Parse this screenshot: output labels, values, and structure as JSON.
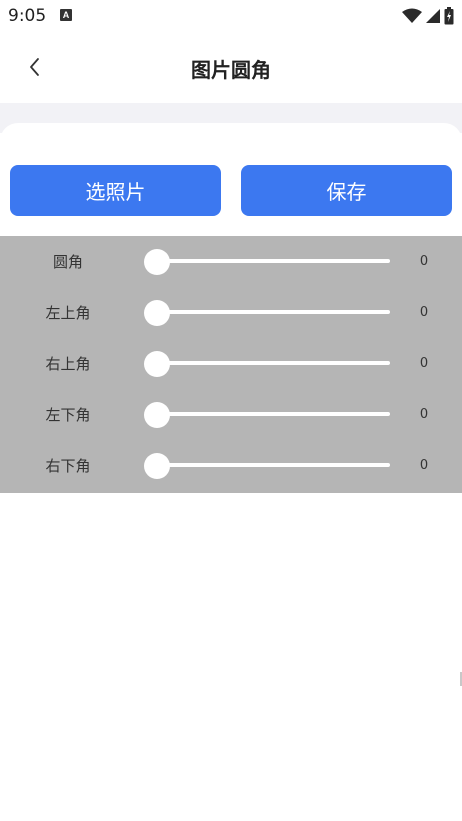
{
  "status_bar": {
    "time": "9:05",
    "notification_badge": "A",
    "icons": [
      "wifi-icon",
      "signal-icon",
      "battery-icon"
    ]
  },
  "header": {
    "title": "图片圆角",
    "back_icon": "chevron-left-icon"
  },
  "actions": {
    "pick_label": "选照片",
    "save_label": "保存",
    "accent_color": "#3c78f0"
  },
  "sliders": [
    {
      "label": "圆角",
      "value": "0"
    },
    {
      "label": "左上角",
      "value": "0"
    },
    {
      "label": "右上角",
      "value": "0"
    },
    {
      "label": "左下角",
      "value": "0"
    },
    {
      "label": "右下角",
      "value": "0"
    }
  ]
}
